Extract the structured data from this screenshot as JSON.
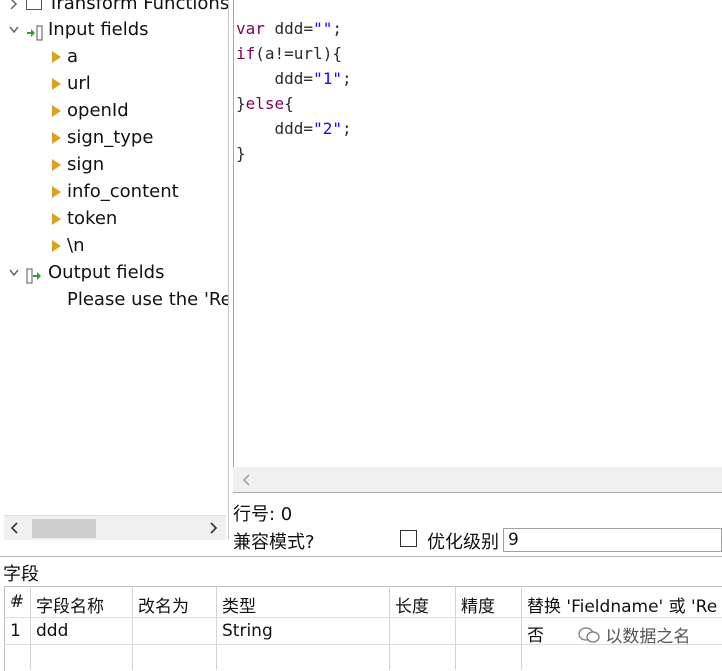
{
  "tree": {
    "transform_functions_label": "Transform Functions",
    "input_fields_label": "Input fields",
    "input_items": [
      "a",
      "url",
      "openId",
      "sign_type",
      "sign",
      "info_content",
      "token",
      "\\n"
    ],
    "output_fields_label": "Output fields",
    "output_hint": "Please use the 'Replace value 'Fieldname' or 'Rename to' '"
  },
  "editor": {
    "lines": [
      [
        {
          "t": "var",
          "c": "kw"
        },
        {
          "t": " ddd=",
          "c": "plain"
        },
        {
          "t": "\"\"",
          "c": "str"
        },
        {
          "t": ";",
          "c": "plain"
        }
      ],
      [
        {
          "t": "if",
          "c": "kw"
        },
        {
          "t": "(a!=url){",
          "c": "plain"
        }
      ],
      [
        {
          "t": "    ddd=",
          "c": "plain"
        },
        {
          "t": "\"1\"",
          "c": "str"
        },
        {
          "t": ";",
          "c": "plain"
        }
      ],
      [
        {
          "t": "}",
          "c": "plain"
        },
        {
          "t": "else",
          "c": "kw"
        },
        {
          "t": "{",
          "c": "plain"
        }
      ],
      [
        {
          "t": "    ddd=",
          "c": "plain"
        },
        {
          "t": "\"2\"",
          "c": "str"
        },
        {
          "t": ";",
          "c": "plain"
        }
      ],
      [
        {
          "t": "}",
          "c": "plain"
        }
      ]
    ]
  },
  "status": {
    "line_number_label": "行号: 0",
    "compat_mode_label": "兼容模式?",
    "optimization_label": "优化级别",
    "optimization_value": "9"
  },
  "fields": {
    "section_title": "字段",
    "columns": [
      "#",
      "字段名称",
      "改名为",
      "类型",
      "长度",
      "精度",
      "替换 'Fieldname' 或 'Re"
    ],
    "rows": [
      [
        "1",
        "ddd",
        "",
        "String",
        "",
        "",
        "否"
      ]
    ]
  },
  "watermark": "以数据之名",
  "colors": {
    "keyword": "#7f0055",
    "string": "#2a00ff",
    "tree_arrow": "#d9a21f"
  }
}
